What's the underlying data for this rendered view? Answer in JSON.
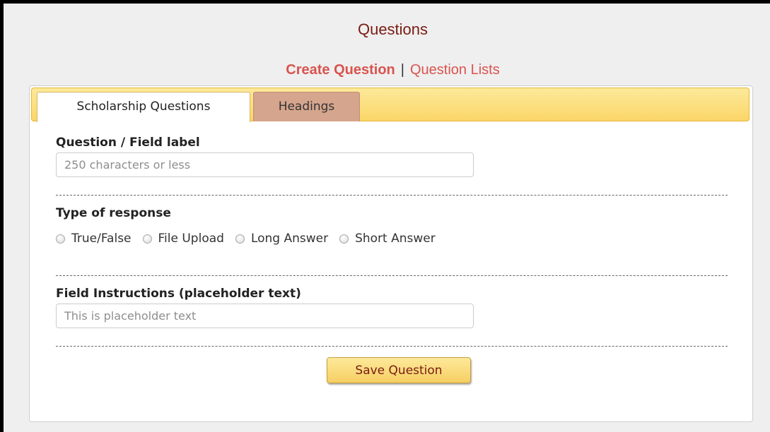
{
  "page": {
    "title": "Questions"
  },
  "subnav": {
    "active_label": "Create Question",
    "separator": "|",
    "link_label": "Question Lists"
  },
  "tabs": [
    {
      "label": "Scholarship Questions",
      "active": true
    },
    {
      "label": "Headings",
      "active": false
    }
  ],
  "form": {
    "question_label": "Question / Field label",
    "question_placeholder": "250 characters or less",
    "question_value": "",
    "response_type_label": "Type of response",
    "response_options": [
      {
        "label": "True/False",
        "selected": false
      },
      {
        "label": "File Upload",
        "selected": false
      },
      {
        "label": "Long Answer",
        "selected": false
      },
      {
        "label": "Short Answer",
        "selected": false
      }
    ],
    "instructions_label": "Field Instructions (placeholder text)",
    "instructions_placeholder": "This is placeholder text",
    "instructions_value": "",
    "save_label": "Save Question"
  },
  "colors": {
    "title": "#7a1b12",
    "accent_link": "#d9534f",
    "tabbar": "#fbd668",
    "inactive_tab": "#d5a58d",
    "button": "#f6cf63"
  },
  "icons": {
    "radio": "radio-unchecked-icon"
  }
}
